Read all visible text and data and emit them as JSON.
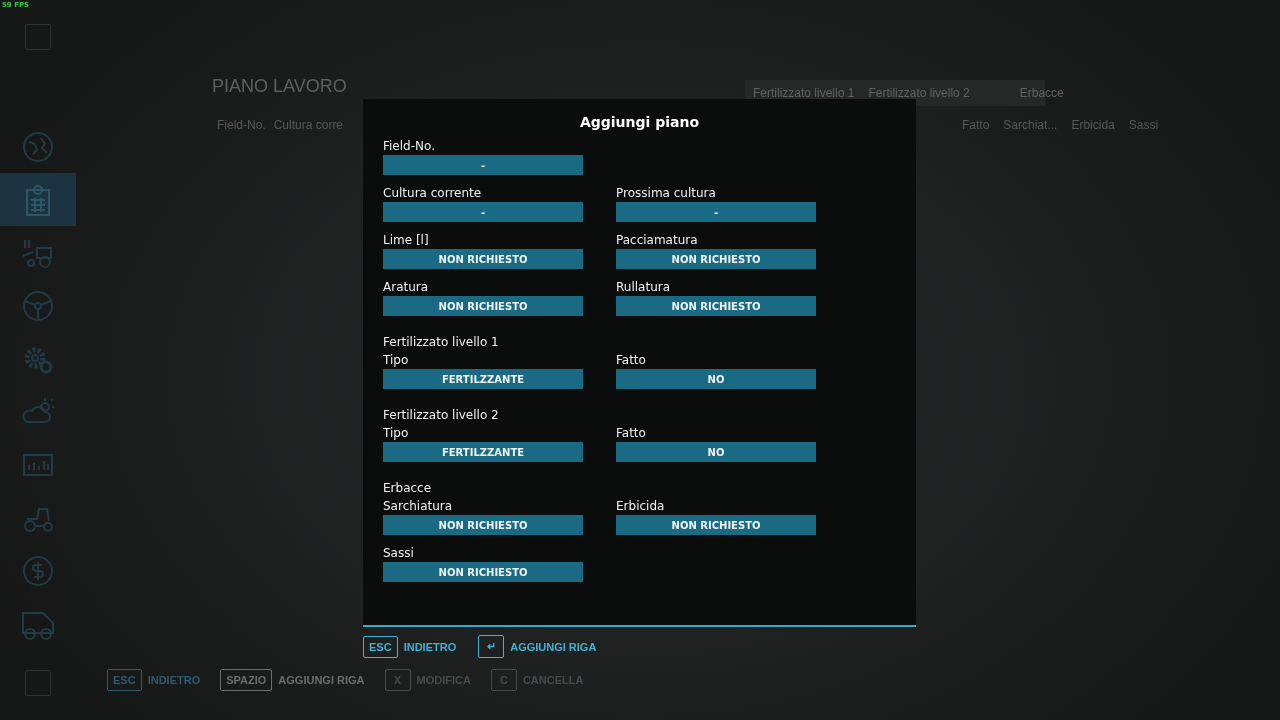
{
  "fps": "59 FPS",
  "page": {
    "title": "PIANO LAVORO",
    "group_headers": [
      "Fertilizzato livello 1",
      "Fertilizzato livello 2",
      "Erbacce"
    ],
    "columns_left": [
      "Field-No.",
      "Cultura corre"
    ],
    "columns_right": [
      "Fatto",
      "Sarchiat...",
      "Erbicida",
      "Sassi"
    ]
  },
  "sidebar": {
    "items": [
      {
        "selected": false
      },
      {
        "selected": true
      },
      {
        "selected": false
      },
      {
        "selected": false
      },
      {
        "selected": false
      },
      {
        "selected": false
      },
      {
        "selected": false
      },
      {
        "selected": false
      },
      {
        "selected": false
      },
      {
        "selected": false
      }
    ]
  },
  "page_actions": [
    {
      "key": "ESC",
      "label": "INDIETRO",
      "disabled": false
    },
    {
      "key": "SPAZIO",
      "label": "AGGIUNGI RIGA",
      "disabled": false
    },
    {
      "key": "X",
      "label": "MODIFICA",
      "disabled": true
    },
    {
      "key": "C",
      "label": "CANCELLA",
      "disabled": true
    }
  ],
  "dialog": {
    "title": "Aggiungi piano",
    "rows": [
      {
        "kind": "fields",
        "fields": [
          {
            "label": "Field-No.",
            "value": "-"
          }
        ]
      },
      {
        "kind": "fields",
        "fields": [
          {
            "label": "Cultura corrente",
            "value": "-"
          },
          {
            "label": "Prossima cultura",
            "value": "-"
          }
        ]
      },
      {
        "kind": "fields",
        "fields": [
          {
            "label": "Lime [l]",
            "value": "NON RICHIESTO"
          },
          {
            "label": "Pacciamatura",
            "value": "NON RICHIESTO"
          }
        ]
      },
      {
        "kind": "fields",
        "fields": [
          {
            "label": "Aratura",
            "value": "NON RICHIESTO"
          },
          {
            "label": "Rullatura",
            "value": "NON RICHIESTO"
          }
        ]
      },
      {
        "kind": "section",
        "label": "Fertilizzato livello 1"
      },
      {
        "kind": "fields",
        "fields": [
          {
            "label": "Tipo",
            "value": "FERTILZZANTE"
          },
          {
            "label": "Fatto",
            "value": "NO"
          }
        ]
      },
      {
        "kind": "section",
        "label": "Fertilizzato livello 2"
      },
      {
        "kind": "fields",
        "fields": [
          {
            "label": "Tipo",
            "value": "FERTILZZANTE"
          },
          {
            "label": "Fatto",
            "value": "NO"
          }
        ]
      },
      {
        "kind": "section",
        "label": "Erbacce"
      },
      {
        "kind": "fields",
        "fields": [
          {
            "label": "Sarchiatura",
            "value": "NON RICHIESTO"
          },
          {
            "label": "Erbicida",
            "value": "NON RICHIESTO"
          }
        ]
      },
      {
        "kind": "fields",
        "fields": [
          {
            "label": "Sassi",
            "value": "NON RICHIESTO"
          }
        ]
      }
    ],
    "actions": [
      {
        "key": "ESC",
        "label": "INDIETRO"
      },
      {
        "key": "↵",
        "label": "AGGIUNGI RIGA"
      }
    ]
  }
}
